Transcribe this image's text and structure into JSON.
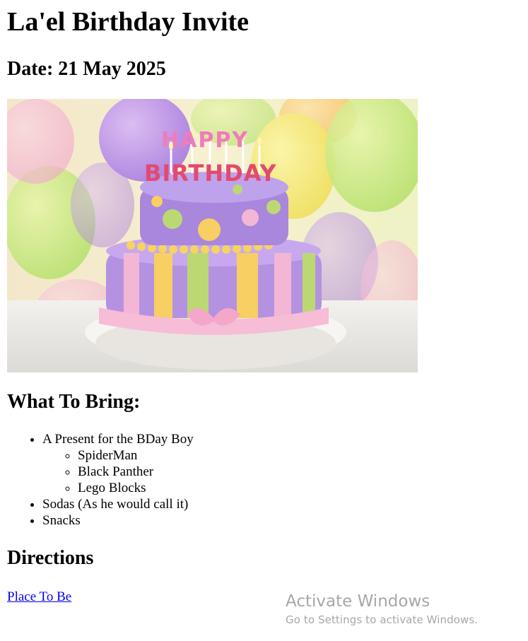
{
  "page": {
    "title": "La'el Birthday Invite",
    "date_heading": "Date: 21 May 2025"
  },
  "hero_image": {
    "icon": "birthday-cake-photo",
    "candle_text": "HAPPY BIRTHDAY"
  },
  "bring": {
    "heading": "What To Bring:",
    "items": [
      {
        "label": "A Present for the BDay Boy",
        "sub": [
          "SpiderMan",
          "Black Panther",
          "Lego Blocks"
        ]
      },
      {
        "label": "Sodas (As he would call it)"
      },
      {
        "label": "Snacks"
      }
    ]
  },
  "directions": {
    "heading": "Directions",
    "link_label": "Place To Be"
  },
  "watermark": {
    "title": "Activate Windows",
    "subtitle": "Go to Settings to activate Windows."
  },
  "colors": {
    "link": "#0000ee",
    "watermark": "#a7a7a7"
  }
}
